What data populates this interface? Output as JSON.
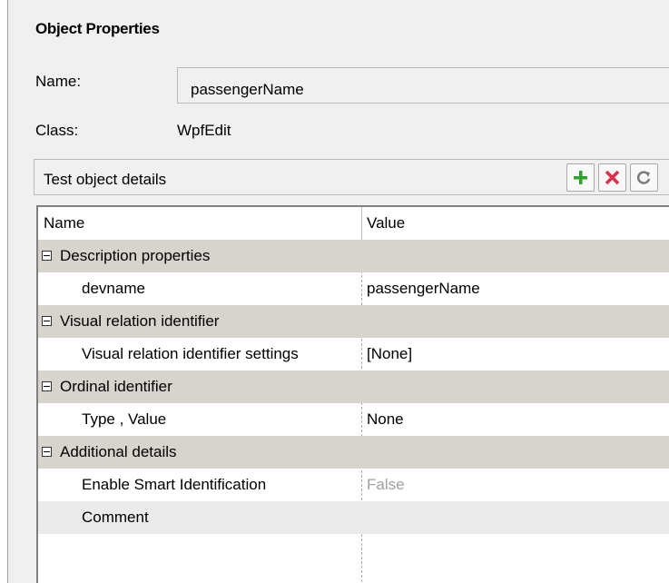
{
  "panel": {
    "title": "Object Properties",
    "name_label": "Name:",
    "name_value": "passengerName",
    "class_label": "Class:",
    "class_value": "WpfEdit"
  },
  "details": {
    "title": "Test object details",
    "buttons": [
      {
        "icon": "plus-icon",
        "color": "#2da32d"
      },
      {
        "icon": "delete-x-icon",
        "color": "#d9304b"
      },
      {
        "icon": "refresh-icon",
        "color": "#7a7a7a"
      }
    ]
  },
  "grid": {
    "col_name": "Name",
    "col_value": "Value",
    "rows": [
      {
        "type": "group",
        "name": "Description properties",
        "value": ""
      },
      {
        "type": "prop",
        "name": "devname",
        "value": "passengerName"
      },
      {
        "type": "group",
        "name": "Visual relation identifier",
        "value": ""
      },
      {
        "type": "prop",
        "name": "Visual relation identifier settings",
        "value": "[None]"
      },
      {
        "type": "group",
        "name": "Ordinal identifier",
        "value": ""
      },
      {
        "type": "prop",
        "name": "Type , Value",
        "value": "None"
      },
      {
        "type": "group",
        "name": "Additional details",
        "value": ""
      },
      {
        "type": "prop",
        "name": "Enable Smart Identification",
        "value": "False",
        "greyed": true
      },
      {
        "type": "prop-alt",
        "name": "Comment",
        "value": ""
      }
    ]
  }
}
